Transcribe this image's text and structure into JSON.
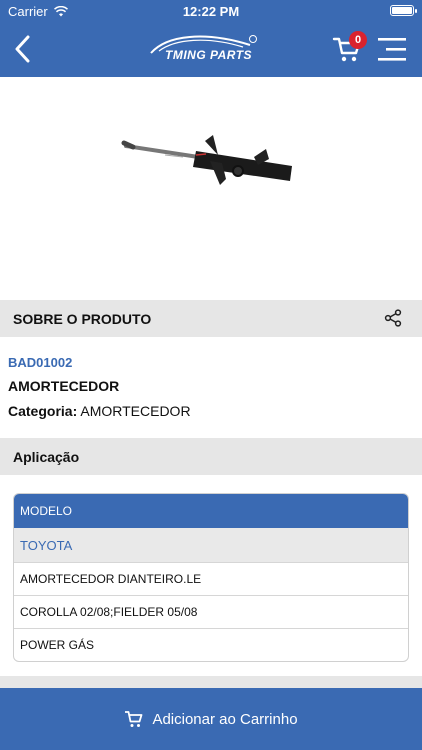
{
  "status_bar": {
    "carrier": "Carrier",
    "time": "12:22 PM"
  },
  "header": {
    "logo_text": "TMING PARTS",
    "cart_count": "0"
  },
  "colors": {
    "primary": "#3a6ab3",
    "badge": "#d9232e",
    "section_bg": "#e6e6e6"
  },
  "icons": [
    "back-arrow-icon",
    "cart-icon",
    "menu-icon",
    "share-icon",
    "wifi-icon",
    "battery-icon",
    "cart-small-icon"
  ],
  "about": {
    "title": "SOBRE O PRODUTO",
    "code": "BAD01002",
    "name": "AMORTECEDOR",
    "category_label": "Categoria:",
    "category_value": "AMORTECEDOR"
  },
  "application": {
    "title": "Aplicação",
    "table_header": "MODELO",
    "brand": "TOYOTA",
    "rows": [
      "AMORTECEDOR DIANTEIRO.LE",
      "COROLLA 02/08;FIELDER 05/08",
      "POWER GÁS"
    ]
  },
  "add_to_cart_label": "Adicionar ao Carrinho"
}
